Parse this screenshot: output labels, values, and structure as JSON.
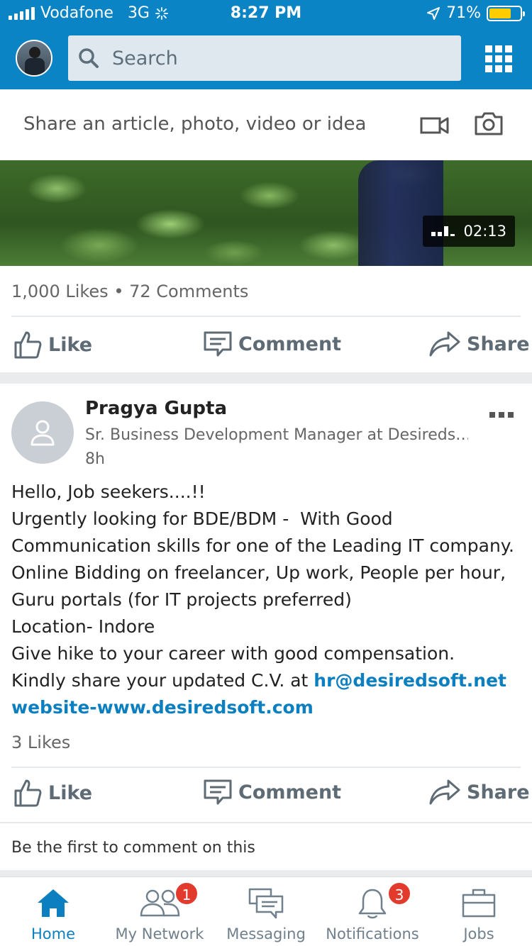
{
  "status": {
    "carrier": "Vodafone",
    "network": "3G",
    "time": "8:27 PM",
    "battery": "71%"
  },
  "header": {
    "search_placeholder": "Search"
  },
  "sharebar": {
    "prompt": "Share an article, photo, video or idea"
  },
  "video": {
    "duration": "02:13"
  },
  "post1": {
    "counts": "1,000 Likes • 72 Comments",
    "like": "Like",
    "comment": "Comment",
    "share": "Share"
  },
  "post2": {
    "author": "Pragya Gupta",
    "title": "Sr. Business Development Manager at Desireds…",
    "time": "8h",
    "lines": [
      "Hello, Job seekers....!!",
      "Urgently looking for BDE/BDM -  With Good",
      "Communication skills for one of the Leading IT company.",
      "Online Bidding on freelancer, Up work, People per hour,",
      "Guru portals (for IT projects preferred)",
      "Location- Indore",
      "Give hike to your career with good compensation.",
      "Kindly share your updated C.V. at "
    ],
    "email": "hr@desiredsoft.net",
    "website": "website-www.desiredsoft.com",
    "likes": "3 Likes",
    "like": "Like",
    "comment": "Comment",
    "share": "Share",
    "first_comment": "Be the first to comment on this"
  },
  "nav": {
    "home": "Home",
    "network": "My Network",
    "network_badge": "1",
    "messaging": "Messaging",
    "notifications": "Notifications",
    "notifications_badge": "3",
    "jobs": "Jobs"
  },
  "colors": {
    "brand": "#0b84c5",
    "link": "#0b7fbf",
    "badge": "#e23b2e",
    "battery": "#ffcc00"
  }
}
